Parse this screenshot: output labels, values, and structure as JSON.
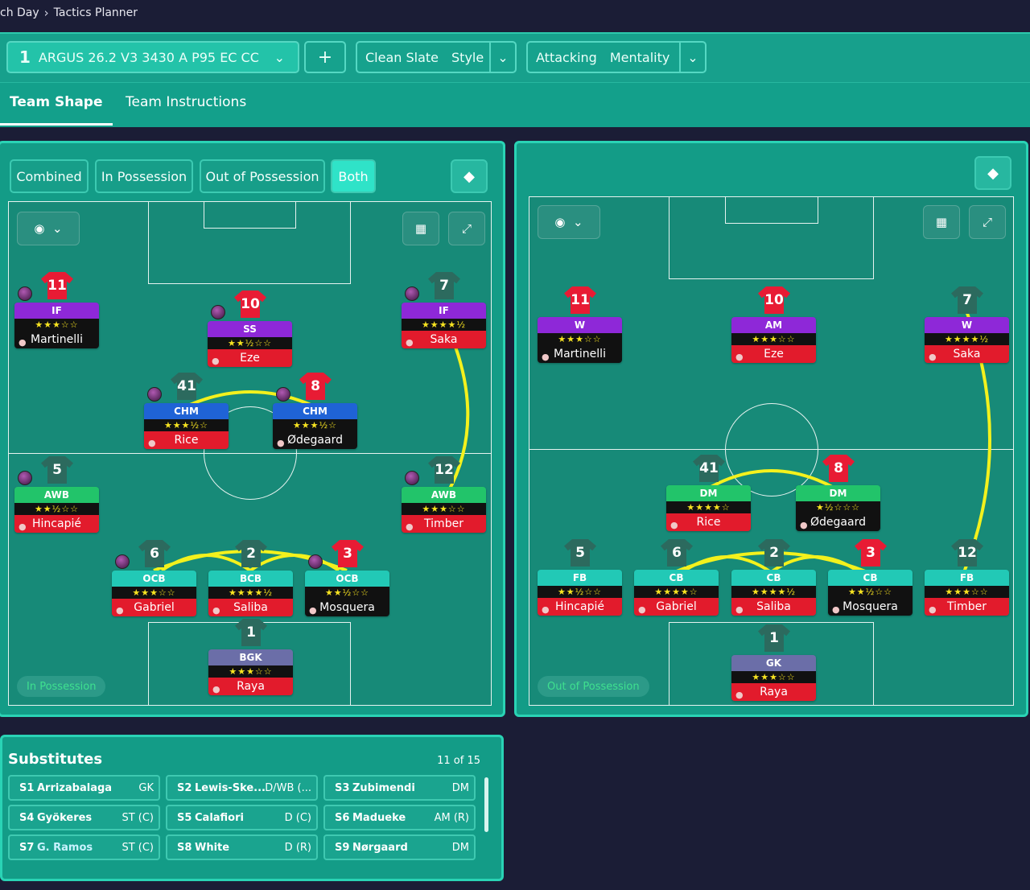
{
  "breadcrumb": {
    "prev": "ch Day",
    "current": "Tactics Planner"
  },
  "tactic": {
    "number": "1",
    "name": "ARGUS 26.2 V3 3430 A P95 EC CC",
    "add_label": "+",
    "style_value": "Clean Slate",
    "style_label": "Style",
    "mentality_value": "Attacking",
    "mentality_label": "Mentality"
  },
  "tabs": {
    "team_shape": "Team Shape",
    "team_instructions": "Team Instructions"
  },
  "segments": {
    "combined": "Combined",
    "in_possession": "In Possession",
    "out_possession": "Out of Possession",
    "both": "Both"
  },
  "phases": {
    "left": "In Possession",
    "right": "Out of Possession"
  },
  "left_players": [
    {
      "num": "11",
      "role": "IF",
      "stars": "★★★☆☆",
      "name": "Martinelli",
      "kit": "red",
      "role_color": "#8e28d8",
      "name_bg": "#111",
      "badge": true
    },
    {
      "num": "10",
      "role": "SS",
      "stars": "★★½☆☆",
      "name": "Eze",
      "kit": "red",
      "role_color": "#8e28d8",
      "name_bg": "#e21b2c",
      "badge": true
    },
    {
      "num": "7",
      "role": "IF",
      "stars": "★★★★½",
      "name": "Saka",
      "kit": "grey",
      "role_color": "#8e28d8",
      "name_bg": "#e21b2c",
      "badge": true
    },
    {
      "num": "41",
      "role": "CHM",
      "stars": "★★★½☆",
      "name": "Rice",
      "kit": "grey",
      "role_color": "#1f63d6",
      "name_bg": "#e21b2c",
      "badge": true
    },
    {
      "num": "8",
      "role": "CHM",
      "stars": "★★★½☆",
      "name": "Ødegaard",
      "kit": "red",
      "role_color": "#1f63d6",
      "name_bg": "#111",
      "badge": true
    },
    {
      "num": "5",
      "role": "AWB",
      "stars": "★★½☆☆",
      "name": "Hincapié",
      "kit": "grey",
      "role_color": "#22c46a",
      "name_bg": "#e21b2c",
      "badge": true
    },
    {
      "num": "12",
      "role": "AWB",
      "stars": "★★★☆☆",
      "name": "Timber",
      "kit": "grey",
      "role_color": "#22c46a",
      "name_bg": "#e21b2c",
      "badge": true
    },
    {
      "num": "6",
      "role": "OCB",
      "stars": "★★★☆☆",
      "name": "Gabriel",
      "kit": "grey",
      "role_color": "#22c9b6",
      "name_bg": "#e21b2c",
      "badge": true
    },
    {
      "num": "2",
      "role": "BCB",
      "stars": "★★★★½",
      "name": "Saliba",
      "kit": "grey",
      "role_color": "#22c9b6",
      "name_bg": "#e21b2c",
      "badge": false
    },
    {
      "num": "3",
      "role": "OCB",
      "stars": "★★½☆☆",
      "name": "Mosquera",
      "kit": "red",
      "role_color": "#22c9b6",
      "name_bg": "#111",
      "badge": true
    },
    {
      "num": "1",
      "role": "BGK",
      "stars": "★★★☆☆",
      "name": "Raya",
      "kit": "grey",
      "role_color": "#6b6ea8",
      "name_bg": "#e21b2c",
      "badge": false
    }
  ],
  "right_players": [
    {
      "num": "11",
      "role": "W",
      "stars": "★★★☆☆",
      "name": "Martinelli",
      "kit": "red",
      "role_color": "#8e28d8",
      "name_bg": "#111"
    },
    {
      "num": "10",
      "role": "AM",
      "stars": "★★★☆☆",
      "name": "Eze",
      "kit": "red",
      "role_color": "#8e28d8",
      "name_bg": "#e21b2c"
    },
    {
      "num": "7",
      "role": "W",
      "stars": "★★★★½",
      "name": "Saka",
      "kit": "grey",
      "role_color": "#8e28d8",
      "name_bg": "#e21b2c"
    },
    {
      "num": "41",
      "role": "DM",
      "stars": "★★★★☆",
      "name": "Rice",
      "kit": "grey",
      "role_color": "#22c46a",
      "name_bg": "#e21b2c"
    },
    {
      "num": "8",
      "role": "DM",
      "stars": "★½☆☆☆",
      "name": "Ødegaard",
      "kit": "red",
      "role_color": "#22c46a",
      "name_bg": "#111"
    },
    {
      "num": "5",
      "role": "FB",
      "stars": "★★½☆☆",
      "name": "Hincapié",
      "kit": "grey",
      "role_color": "#22c9b6",
      "name_bg": "#e21b2c"
    },
    {
      "num": "6",
      "role": "CB",
      "stars": "★★★★☆",
      "name": "Gabriel",
      "kit": "grey",
      "role_color": "#22c9b6",
      "name_bg": "#e21b2c"
    },
    {
      "num": "2",
      "role": "CB",
      "stars": "★★★★½",
      "name": "Saliba",
      "kit": "grey",
      "role_color": "#22c9b6",
      "name_bg": "#e21b2c"
    },
    {
      "num": "3",
      "role": "CB",
      "stars": "★★½☆☆",
      "name": "Mosquera",
      "kit": "red",
      "role_color": "#22c9b6",
      "name_bg": "#111"
    },
    {
      "num": "12",
      "role": "FB",
      "stars": "★★★☆☆",
      "name": "Timber",
      "kit": "grey",
      "role_color": "#22c9b6",
      "name_bg": "#e21b2c"
    },
    {
      "num": "1",
      "role": "GK",
      "stars": "★★★☆☆",
      "name": "Raya",
      "kit": "grey",
      "role_color": "#6b6ea8",
      "name_bg": "#e21b2c"
    }
  ],
  "substitutes": {
    "title": "Substitutes",
    "count": "11 of 15",
    "items": [
      {
        "num": "S1",
        "name": "Arrizabalaga",
        "pos": "GK"
      },
      {
        "num": "S2",
        "name": "Lewis-Ske...",
        "pos": "D/WB (..."
      },
      {
        "num": "S3",
        "name": "Zubimendi",
        "pos": "DM"
      },
      {
        "num": "S4",
        "name": "Gyökeres",
        "pos": "ST (C)"
      },
      {
        "num": "S5",
        "name": "Calafiori",
        "pos": "D (C)"
      },
      {
        "num": "S6",
        "name": "Madueke",
        "pos": "AM (R)"
      },
      {
        "num": "S7",
        "name": "G. Ramos",
        "pos": "ST (C)",
        "highlight": true
      },
      {
        "num": "S8",
        "name": "White",
        "pos": "D (R)"
      },
      {
        "num": "S9",
        "name": "Nørgaard",
        "pos": "DM"
      }
    ]
  }
}
